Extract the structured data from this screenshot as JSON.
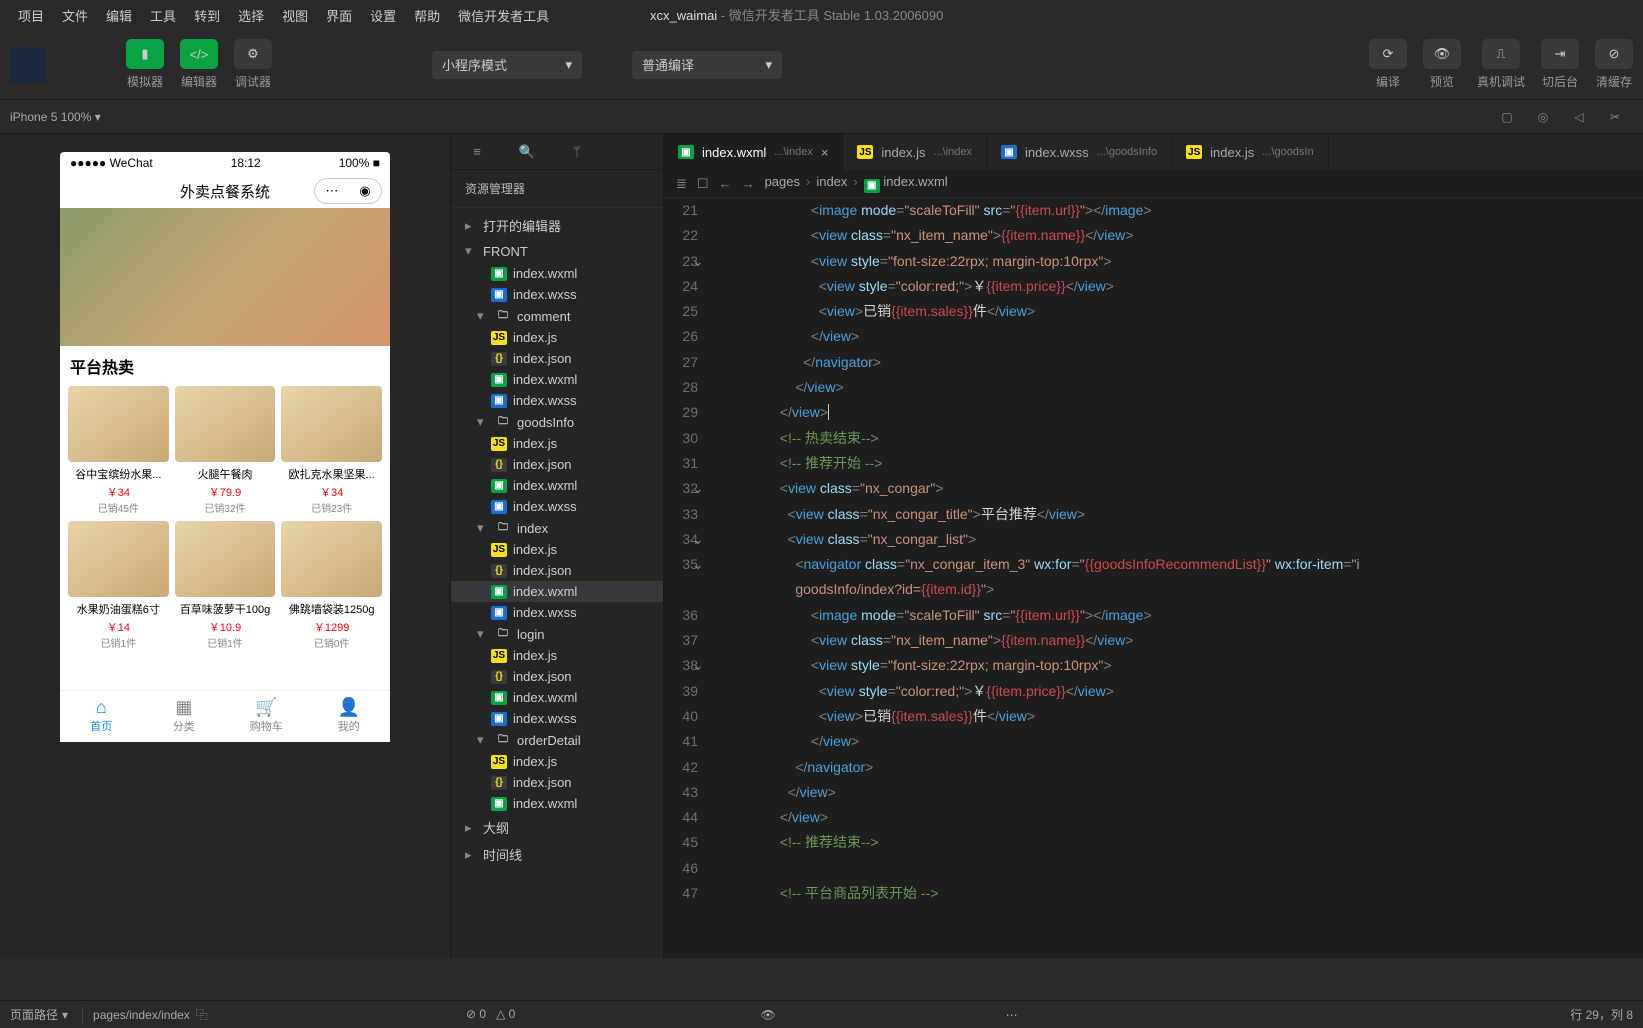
{
  "menu": [
    "项目",
    "文件",
    "编辑",
    "工具",
    "转到",
    "选择",
    "视图",
    "界面",
    "设置",
    "帮助",
    "微信开发者工具"
  ],
  "window_title": {
    "project": "xcx_waimai",
    "suffix": " - 微信开发者工具 Stable 1.03.2006090"
  },
  "toolbar": {
    "simulator": "模拟器",
    "editor": "编辑器",
    "debugger": "调试器",
    "mode": "小程序模式",
    "compile_mode": "普通编译",
    "compile": "编译",
    "preview": "预览",
    "remote": "真机调试",
    "background": "切后台",
    "clear": "清缓存"
  },
  "devicebar": {
    "device": "iPhone 5 100%",
    "chev": "▾"
  },
  "explorer": {
    "title": "资源管理器",
    "opened": "打开的编辑器",
    "root": "FRONT",
    "outline": "大纲",
    "timeline": "时间线",
    "folders": {
      "comment": "comment",
      "goodsInfo": "goodsInfo",
      "index": "index",
      "login": "login",
      "orderDetail": "orderDetail"
    },
    "files": {
      "indexjs": "index.js",
      "indexjson": "index.json",
      "indexwxml": "index.wxml",
      "indexwxss": "index.wxss"
    }
  },
  "tabs": [
    {
      "icon": "wxml",
      "name": "index.wxml",
      "path": "...\\index",
      "active": true,
      "close": true
    },
    {
      "icon": "js",
      "name": "index.js",
      "path": "...\\index"
    },
    {
      "icon": "wxss",
      "name": "index.wxss",
      "path": "...\\goodsInfo"
    },
    {
      "icon": "js",
      "name": "index.js",
      "path": "...\\goodsIn"
    }
  ],
  "breadcrumb": {
    "a": "pages",
    "b": "index",
    "c": "index.wxml"
  },
  "code": [
    {
      "n": 21,
      "ind": 4,
      "html": "<span class='t-punc'>&lt;</span><span class='t-tag'>image</span> <span class='t-attr'>mode</span><span class='t-punc'>=</span><span class='t-str'>\"scaleToFill\"</span> <span class='t-attr'>src</span><span class='t-punc'>=</span><span class='t-str'>\"</span><span class='t-red'>{{item.url}}</span><span class='t-str'>\"</span><span class='t-punc'>&gt;&lt;/</span><span class='t-tag'>image</span><span class='t-punc'>&gt;</span>"
    },
    {
      "n": 22,
      "ind": 4,
      "html": "<span class='t-punc'>&lt;</span><span class='t-tag'>view</span> <span class='t-attr'>class</span><span class='t-punc'>=</span><span class='t-str'>\"nx_item_name\"</span><span class='t-punc'>&gt;</span><span class='t-red'>{{item.name}}</span><span class='t-punc'>&lt;/</span><span class='t-tag'>view</span><span class='t-punc'>&gt;</span>"
    },
    {
      "n": 23,
      "ind": 4,
      "fold": true,
      "html": "<span class='t-punc'>&lt;</span><span class='t-tag'>view</span> <span class='t-attr'>style</span><span class='t-punc'>=</span><span class='t-str'>\"font-size:22rpx; margin-top:10rpx\"</span><span class='t-punc'>&gt;</span>"
    },
    {
      "n": 24,
      "ind": 5,
      "html": "<span class='t-punc'>&lt;</span><span class='t-tag'>view</span> <span class='t-attr'>style</span><span class='t-punc'>=</span><span class='t-str'>\"color:red;\"</span><span class='t-punc'>&gt;</span><span class='t-expr'>￥</span><span class='t-red'>{{item.price}}</span><span class='t-punc'>&lt;/</span><span class='t-tag'>view</span><span class='t-punc'>&gt;</span>"
    },
    {
      "n": 25,
      "ind": 5,
      "html": "<span class='t-punc'>&lt;</span><span class='t-tag'>view</span><span class='t-punc'>&gt;</span><span class='t-expr'>已销</span><span class='t-red'>{{item.sales}}</span><span class='t-expr'>件</span><span class='t-punc'>&lt;/</span><span class='t-tag'>view</span><span class='t-punc'>&gt;</span>"
    },
    {
      "n": 26,
      "ind": 4,
      "html": "<span class='t-punc'>&lt;/</span><span class='t-tag'>view</span><span class='t-punc'>&gt;</span>"
    },
    {
      "n": 27,
      "ind": 3,
      "html": "<span class='t-punc'>&lt;/</span><span class='t-tag'>navigator</span><span class='t-punc'>&gt;</span>"
    },
    {
      "n": 28,
      "ind": 2,
      "html": "<span class='t-punc'>&lt;/</span><span class='t-tag'>view</span><span class='t-punc'>&gt;</span>"
    },
    {
      "n": 29,
      "ind": 0,
      "cursor": true,
      "html": "<span class='t-punc'>&lt;/</span><span class='t-tag'>view</span><span class='t-punc'>&gt;</span>"
    },
    {
      "n": 30,
      "ind": 0,
      "html": "<span class='t-cmt'>&lt;!-- 热卖结束--&gt;</span>"
    },
    {
      "n": 31,
      "ind": 0,
      "html": "<span class='t-cmt'>&lt;!-- 推荐开始 --&gt;</span>"
    },
    {
      "n": 32,
      "ind": 0,
      "fold": true,
      "html": "<span class='t-punc'>&lt;</span><span class='t-tag'>view</span> <span class='t-attr'>class</span><span class='t-punc'>=</span><span class='t-str'>\"nx_congar\"</span><span class='t-punc'>&gt;</span>"
    },
    {
      "n": 33,
      "ind": 1,
      "html": "<span class='t-punc'>&lt;</span><span class='t-tag'>view</span> <span class='t-attr'>class</span><span class='t-punc'>=</span><span class='t-str'>\"nx_congar_title\"</span><span class='t-punc'>&gt;</span><span class='t-expr'>平台推荐</span><span class='t-punc'>&lt;/</span><span class='t-tag'>view</span><span class='t-punc'>&gt;</span>"
    },
    {
      "n": 34,
      "ind": 1,
      "fold": true,
      "html": "<span class='t-punc'>&lt;</span><span class='t-tag'>view</span> <span class='t-attr'>class</span><span class='t-punc'>=</span><span class='t-str'>\"nx_congar_list\"</span><span class='t-punc'>&gt;</span>"
    },
    {
      "n": 35,
      "ind": 2,
      "fold": true,
      "html": "<span class='t-punc'>&lt;</span><span class='t-tag'>navigator</span> <span class='t-attr'>class</span><span class='t-punc'>=</span><span class='t-str'>\"nx_congar_item_3\"</span> <span class='t-attr'>wx:for</span><span class='t-punc'>=</span><span class='t-str'>\"</span><span class='t-red'>{{goodsInfoRecommendList}}</span><span class='t-str'>\"</span> <span class='t-attr'>wx:for-item</span><span class='t-punc'>=</span><span class='t-str'>\"i</span>"
    },
    {
      "n": "",
      "ind": 2,
      "html": "<span class='t-str'>goodsInfo/index?id=</span><span class='t-red'>{{item.id}}</span><span class='t-str'>\"</span><span class='t-punc'>&gt;</span>"
    },
    {
      "n": 36,
      "ind": 4,
      "html": "<span class='t-punc'>&lt;</span><span class='t-tag'>image</span> <span class='t-attr'>mode</span><span class='t-punc'>=</span><span class='t-str'>\"scaleToFill\"</span> <span class='t-attr'>src</span><span class='t-punc'>=</span><span class='t-str'>\"</span><span class='t-red'>{{item.url}}</span><span class='t-str'>\"</span><span class='t-punc'>&gt;&lt;/</span><span class='t-tag'>image</span><span class='t-punc'>&gt;</span>"
    },
    {
      "n": 37,
      "ind": 4,
      "html": "<span class='t-punc'>&lt;</span><span class='t-tag'>view</span> <span class='t-attr'>class</span><span class='t-punc'>=</span><span class='t-str'>\"nx_item_name\"</span><span class='t-punc'>&gt;</span><span class='t-red'>{{item.name}}</span><span class='t-punc'>&lt;/</span><span class='t-tag'>view</span><span class='t-punc'>&gt;</span>"
    },
    {
      "n": 38,
      "ind": 4,
      "fold": true,
      "html": "<span class='t-punc'>&lt;</span><span class='t-tag'>view</span> <span class='t-attr'>style</span><span class='t-punc'>=</span><span class='t-str'>\"font-size:22rpx; margin-top:10rpx\"</span><span class='t-punc'>&gt;</span>"
    },
    {
      "n": 39,
      "ind": 5,
      "html": "<span class='t-punc'>&lt;</span><span class='t-tag'>view</span> <span class='t-attr'>style</span><span class='t-punc'>=</span><span class='t-str'>\"color:red;\"</span><span class='t-punc'>&gt;</span><span class='t-expr'>￥</span><span class='t-red'>{{item.price}}</span><span class='t-punc'>&lt;/</span><span class='t-tag'>view</span><span class='t-punc'>&gt;</span>"
    },
    {
      "n": 40,
      "ind": 5,
      "html": "<span class='t-punc'>&lt;</span><span class='t-tag'>view</span><span class='t-punc'>&gt;</span><span class='t-expr'>已销</span><span class='t-red'>{{item.sales}}</span><span class='t-expr'>件</span><span class='t-punc'>&lt;/</span><span class='t-tag'>view</span><span class='t-punc'>&gt;</span>"
    },
    {
      "n": 41,
      "ind": 4,
      "html": "<span class='t-punc'>&lt;/</span><span class='t-tag'>view</span><span class='t-punc'>&gt;</span>"
    },
    {
      "n": 42,
      "ind": 2,
      "html": "<span class='t-punc'>&lt;/</span><span class='t-tag'>navigator</span><span class='t-punc'>&gt;</span>"
    },
    {
      "n": 43,
      "ind": 1,
      "html": "<span class='t-punc'>&lt;/</span><span class='t-tag'>view</span><span class='t-punc'>&gt;</span>"
    },
    {
      "n": 44,
      "ind": 0,
      "html": "<span class='t-punc'>&lt;/</span><span class='t-tag'>view</span><span class='t-punc'>&gt;</span>"
    },
    {
      "n": 45,
      "ind": 0,
      "html": "<span class='t-cmt'>&lt;!-- 推荐结束--&gt;</span>"
    },
    {
      "n": 46,
      "ind": 0,
      "html": ""
    },
    {
      "n": 47,
      "ind": 0,
      "html": "<span class='t-cmt'>&lt;!-- 平台商品列表开始 --&gt;</span>"
    }
  ],
  "phone": {
    "status_signal": "●●●●●",
    "status_carrier": "WeChat",
    "status_time": "18:12",
    "status_batt": "100%",
    "title": "外卖点餐系统",
    "hot_title": "平台热卖",
    "items": [
      {
        "name": "谷中宝缤纷水果...",
        "price": "￥34",
        "sales": "已销45件"
      },
      {
        "name": "火腿午餐肉",
        "price": "￥79.9",
        "sales": "已销32件"
      },
      {
        "name": "欧扎克水果坚果...",
        "price": "￥34",
        "sales": "已销23件"
      },
      {
        "name": "水果奶油蛋糕6寸",
        "price": "￥14",
        "sales": "已销1件"
      },
      {
        "name": "百草味菠萝干100g",
        "price": "￥10.9",
        "sales": "已销1件"
      },
      {
        "name": "佛跳墙袋装1250g",
        "price": "￥1299",
        "sales": "已销0件"
      }
    ],
    "tabs": [
      {
        "l": "首页",
        "a": true
      },
      {
        "l": "分类"
      },
      {
        "l": "购物车"
      },
      {
        "l": "我的"
      }
    ]
  },
  "status": {
    "path_label": "页面路径",
    "path_value": "pages/index/index",
    "errors": "0",
    "warnings": "0",
    "cursor": "行 29，列 8"
  }
}
